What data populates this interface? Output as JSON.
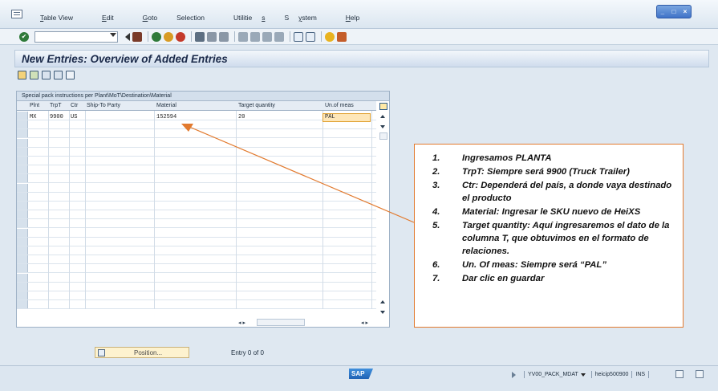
{
  "menu": {
    "items": [
      {
        "name": "menu-table-view",
        "pre": "",
        "ul": "T",
        "post": "able View"
      },
      {
        "name": "menu-edit",
        "pre": "",
        "ul": "E",
        "post": "dit"
      },
      {
        "name": "menu-goto",
        "pre": "",
        "ul": "G",
        "post": "oto"
      },
      {
        "name": "menu-selection",
        "pre": "Selection",
        "ul": "",
        "post": ""
      },
      {
        "name": "menu-utilities",
        "pre": "Utilitie",
        "ul": "s",
        "post": ""
      },
      {
        "name": "menu-system",
        "pre": "S",
        "ul": "y",
        "post": "stem"
      },
      {
        "name": "menu-help",
        "pre": "",
        "ul": "H",
        "post": "elp"
      }
    ]
  },
  "window_controls": {
    "minimize": "_",
    "maximize": "□",
    "close": "×"
  },
  "toolbar": {
    "command_value": ""
  },
  "title": "New Entries: Overview of Added Entries",
  "table": {
    "caption": "Special pack instructions per Plant\\MoT\\Destination\\Material",
    "headers": [
      "Plnt",
      "TrpT",
      "Ctr",
      "Ship-To Party",
      "Material",
      "Target quantity",
      "Un.of meas"
    ],
    "row1": {
      "plnt": "MX",
      "trpt": "9900",
      "ctr": "US",
      "ship_to": "",
      "material": "152594",
      "target_qty": "20",
      "uom": "PAL"
    },
    "hscroll_left": "◂ ▸",
    "hscroll_right": "◂ ▸"
  },
  "position_button": {
    "label": "Position..."
  },
  "entry_text": "Entry 0 of 0",
  "status": {
    "sap_logo": "SAP",
    "transaction": "YV00_PACK_MDAT",
    "server": "heicip500900",
    "mode": "INS"
  },
  "annotation": {
    "items": [
      {
        "num": "1.",
        "text": "Ingresamos PLANTA"
      },
      {
        "num": "2.",
        "text": "TrpT: Siempre será 9900 (Truck Trailer)"
      },
      {
        "num": "3.",
        "text": "Ctr: Dependerá del país, a donde vaya destinado el producto"
      },
      {
        "num": "4.",
        "text": "Material: Ingresar le SKU nuevo de HeiXS"
      },
      {
        "num": "5.",
        "text": "Target quantity: Aquí ingresaremos el dato de la columna T, que obtuvimos en el formato de relaciones."
      },
      {
        "num": "6.",
        "text": "Un. Of meas: Siempre será “PAL”"
      },
      {
        "num": "7.",
        "text": "Dar clic en guardar"
      }
    ],
    "color": "#e27a2e"
  }
}
